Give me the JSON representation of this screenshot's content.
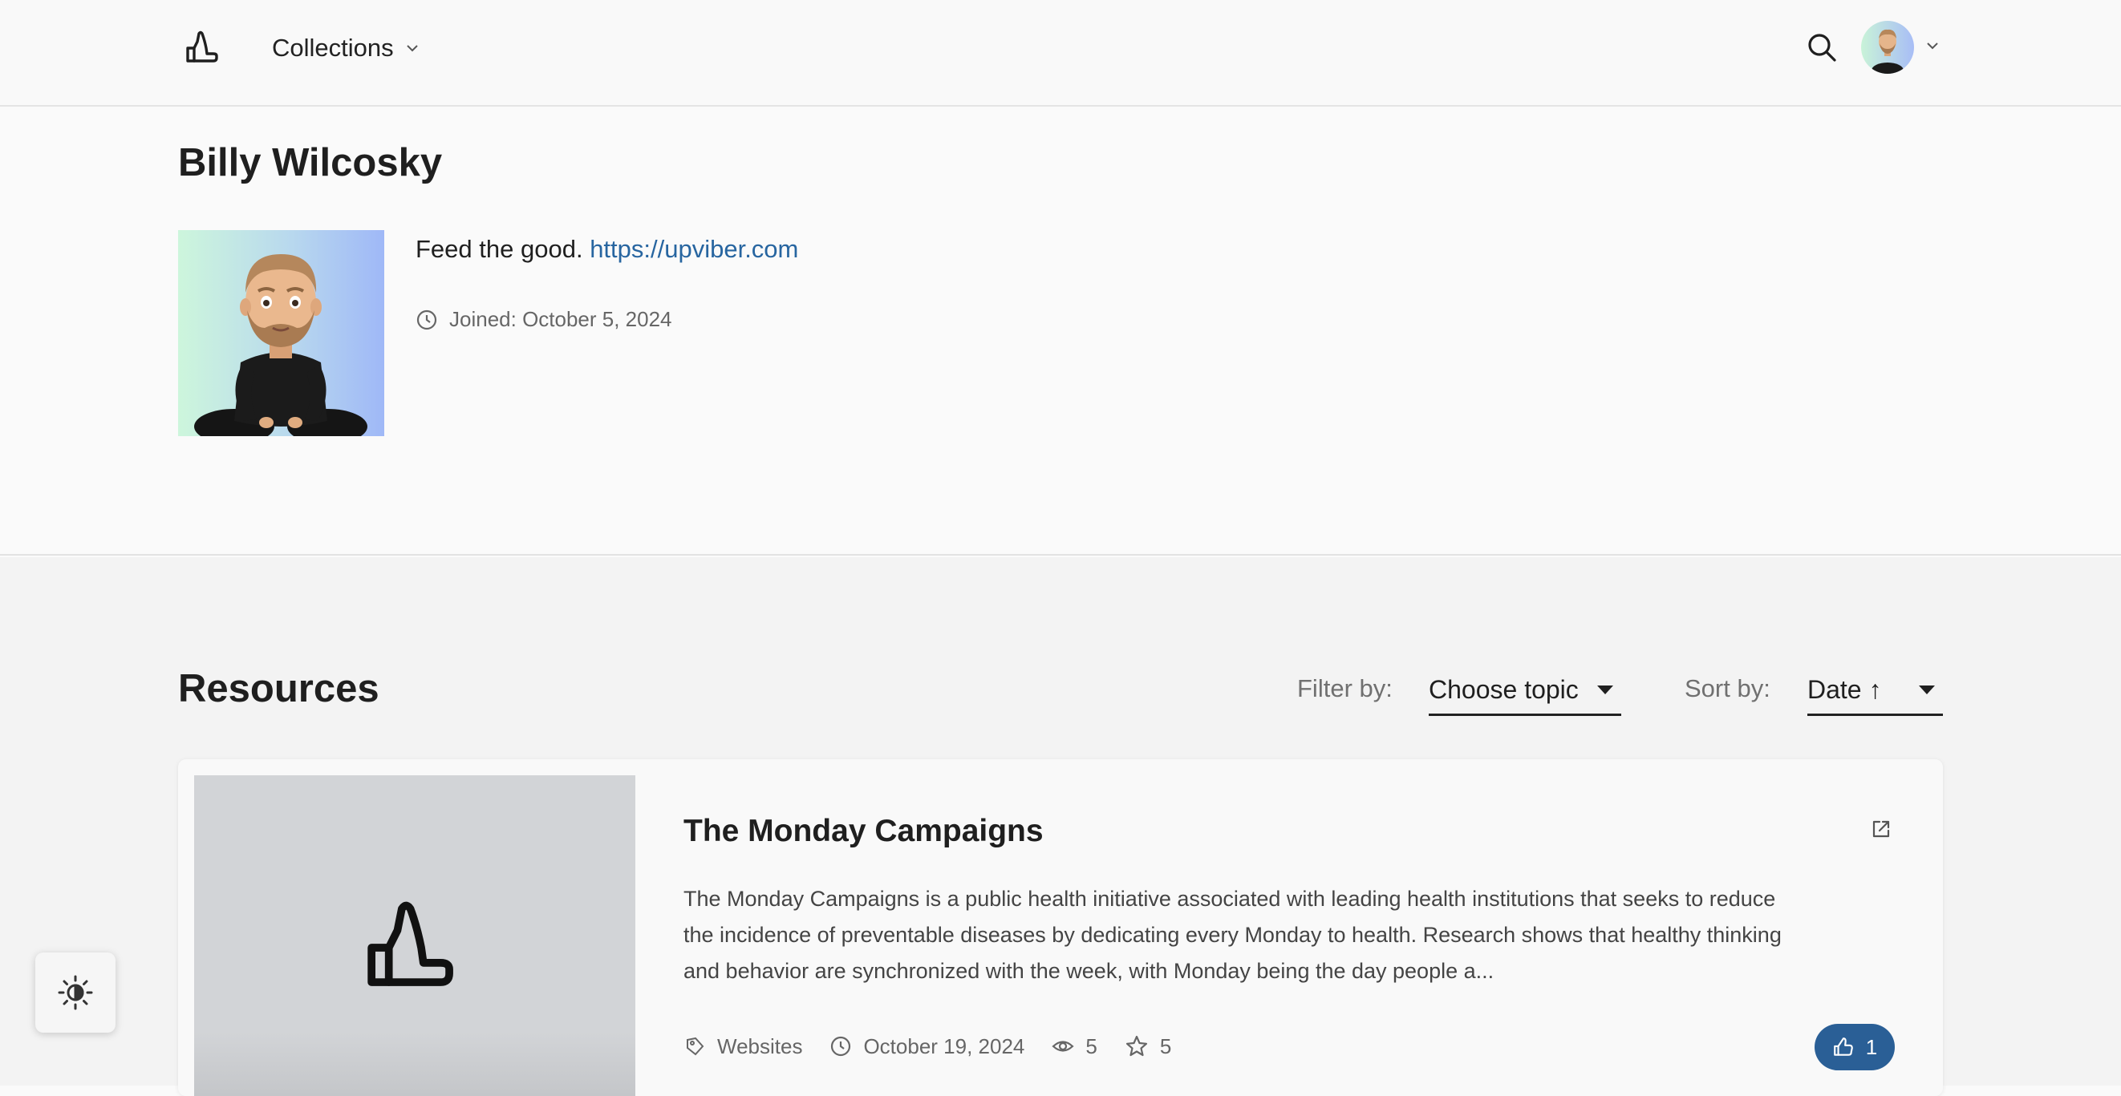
{
  "header": {
    "collections_label": "Collections"
  },
  "profile": {
    "name": "Billy Wilcosky",
    "bio_text": "Feed the good.",
    "bio_link": "https://upviber.com",
    "joined": "Joined: October 5, 2024"
  },
  "resources": {
    "title": "Resources",
    "filter_label": "Filter by:",
    "filter_value": "Choose topic",
    "sort_label": "Sort by:",
    "sort_value": "Date ↑",
    "items": [
      {
        "title": "The Monday Campaigns",
        "description": "The Monday Campaigns is a public health initiative associated with leading health institutions that seeks to reduce the incidence of preventable diseases by dedicating every Monday to health. Research shows that healthy thinking and behavior are synchronized with the week, with Monday being the day people a...",
        "category": "Websites",
        "date": "October 19, 2024",
        "views": "5",
        "stars": "5",
        "likes": "1"
      }
    ]
  },
  "colors": {
    "accent": "#2a5f96",
    "link": "#2765a0",
    "background": "#fafafa"
  },
  "icons": [
    "thumbs-up-logo-icon",
    "chevron-down-icon",
    "search-icon",
    "clock-icon",
    "external-link-icon",
    "tag-icon",
    "eye-icon",
    "star-icon",
    "thumbs-up-icon",
    "theme-contrast-icon"
  ]
}
